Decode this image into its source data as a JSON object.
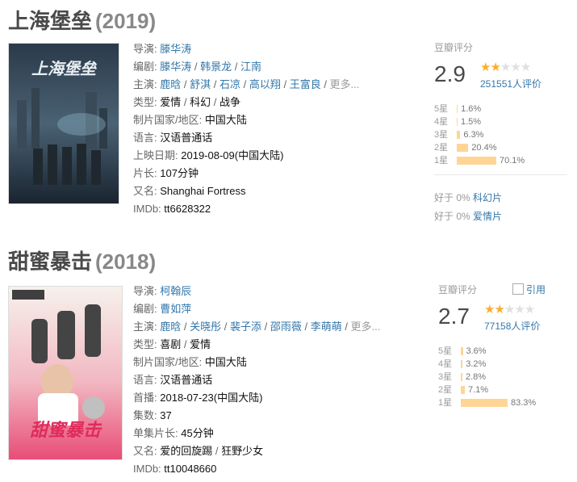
{
  "movies": [
    {
      "title": "上海堡垒",
      "year": "(2019)",
      "poster_text": "上海堡垒",
      "info": {
        "director_label": "导演:",
        "director": "滕华涛",
        "writer_label": "编剧:",
        "writers": [
          "滕华涛",
          "韩景龙",
          "江南"
        ],
        "cast_label": "主演:",
        "cast": [
          "鹿晗",
          "舒淇",
          "石凉",
          "高以翔",
          "王富良"
        ],
        "more": "更多...",
        "genre_label": "类型:",
        "genres": [
          "爱情",
          "科幻",
          "战争"
        ],
        "country_label": "制片国家/地区:",
        "country": "中国大陆",
        "language_label": "语言:",
        "language": "汉语普通话",
        "date_label": "上映日期:",
        "date": "2019-08-09(中国大陆)",
        "runtime_label": "片长:",
        "runtime": "107分钟",
        "aka_label": "又名:",
        "aka": "Shanghai Fortress",
        "imdb_label": "IMDb:",
        "imdb": "tt6628322"
      },
      "rating": {
        "label": "豆瓣评分",
        "score": "2.9",
        "stars": 1.5,
        "votes": "251551人评价",
        "dist": [
          {
            "label": "5星",
            "pct": "1.6%",
            "value": 1.6
          },
          {
            "label": "4星",
            "pct": "1.5%",
            "value": 1.5
          },
          {
            "label": "3星",
            "pct": "6.3%",
            "value": 6.3
          },
          {
            "label": "2星",
            "pct": "20.4%",
            "value": 20.4
          },
          {
            "label": "1星",
            "pct": "70.1%",
            "value": 70.1
          }
        ],
        "better": [
          {
            "prefix": "好于",
            "pct": "0%",
            "genre": "科幻片"
          },
          {
            "prefix": "好于",
            "pct": "0%",
            "genre": "爱情片"
          }
        ]
      }
    },
    {
      "title": "甜蜜暴击",
      "year": "(2018)",
      "poster_text": "甜蜜暴击",
      "info": {
        "director_label": "导演:",
        "director": "柯翰辰",
        "writer_label": "编剧:",
        "writers": [
          "曹如萍"
        ],
        "cast_label": "主演:",
        "cast": [
          "鹿晗",
          "关晓彤",
          "裴子添",
          "邵雨薇",
          "李萌萌"
        ],
        "more": "更多...",
        "genre_label": "类型:",
        "genres": [
          "喜剧",
          "爱情"
        ],
        "country_label": "制片国家/地区:",
        "country": "中国大陆",
        "language_label": "语言:",
        "language": "汉语普通话",
        "date_label": "首播:",
        "date": "2018-07-23(中国大陆)",
        "episodes_label": "集数:",
        "episodes": "37",
        "runtime_label": "单集片长:",
        "runtime": "45分钟",
        "aka_label": "又名:",
        "aka": [
          "爱的回旋踢",
          "狂野少女"
        ],
        "imdb_label": "IMDb:",
        "imdb": "tt10048660"
      },
      "rating": {
        "label": "豆瓣评分",
        "ref": "引用",
        "score": "2.7",
        "stars": 1.5,
        "votes": "77158人评价",
        "dist": [
          {
            "label": "5星",
            "pct": "3.6%",
            "value": 3.6
          },
          {
            "label": "4星",
            "pct": "3.2%",
            "value": 3.2
          },
          {
            "label": "3星",
            "pct": "2.8%",
            "value": 2.8
          },
          {
            "label": "2星",
            "pct": "7.1%",
            "value": 7.1
          },
          {
            "label": "1星",
            "pct": "83.3%",
            "value": 83.3
          }
        ]
      }
    }
  ],
  "colors": {
    "link": "#3377aa",
    "star": "#ffac2d",
    "bar": "#ffd596"
  }
}
